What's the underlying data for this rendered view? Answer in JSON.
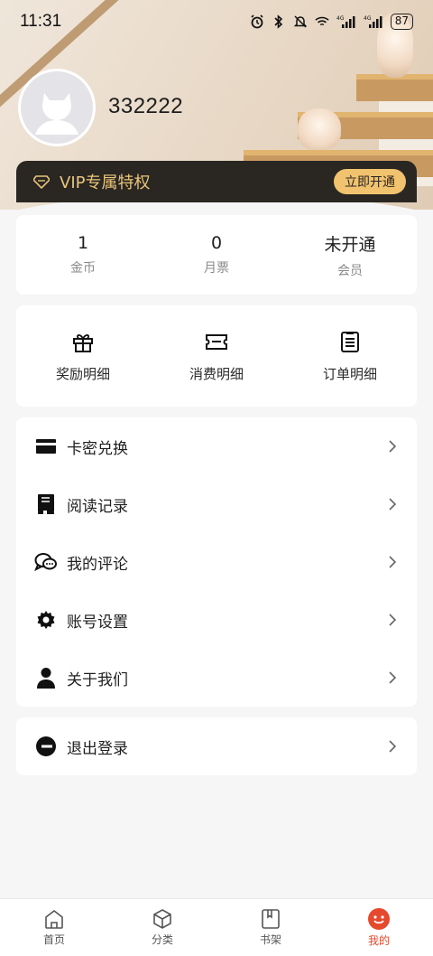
{
  "status_bar": {
    "time": "11:31",
    "icons": [
      "alarm-icon",
      "bluetooth-icon",
      "mute-icon",
      "wifi-icon",
      "signal-4g-icon",
      "signal-4g-icon",
      "battery-icon"
    ],
    "network_1": "4G",
    "network_2": "4G",
    "battery": "87"
  },
  "profile": {
    "username": "332222"
  },
  "vip": {
    "label": "VIP专属特权",
    "button": "立即开通",
    "accent": "#e8c57b",
    "button_color": "#f1c36e"
  },
  "stats": [
    {
      "value": "1",
      "label": "金币"
    },
    {
      "value": "0",
      "label": "月票"
    },
    {
      "value": "未开通",
      "label": "会员"
    }
  ],
  "quick_actions": [
    {
      "icon": "gift-icon",
      "label": "奖励明细"
    },
    {
      "icon": "ticket-icon",
      "label": "消费明细"
    },
    {
      "icon": "clipboard-icon",
      "label": "订单明细"
    }
  ],
  "menu": [
    {
      "icon": "card-icon",
      "label": "卡密兑换"
    },
    {
      "icon": "book-icon",
      "label": "阅读记录"
    },
    {
      "icon": "chat-icon",
      "label": "我的评论"
    },
    {
      "icon": "gear-icon",
      "label": "账号设置"
    },
    {
      "icon": "person-icon",
      "label": "关于我们"
    }
  ],
  "logout": {
    "icon": "logout-icon",
    "label": "退出登录"
  },
  "bottom_nav": [
    {
      "icon": "home-icon",
      "label": "首页",
      "active": false
    },
    {
      "icon": "category-icon",
      "label": "分类",
      "active": false
    },
    {
      "icon": "bookshelf-icon",
      "label": "书架",
      "active": false
    },
    {
      "icon": "profile-face-icon",
      "label": "我的",
      "active": true
    }
  ],
  "colors": {
    "active_tab": "#e6492d",
    "vip_bar": "#2a2622"
  }
}
